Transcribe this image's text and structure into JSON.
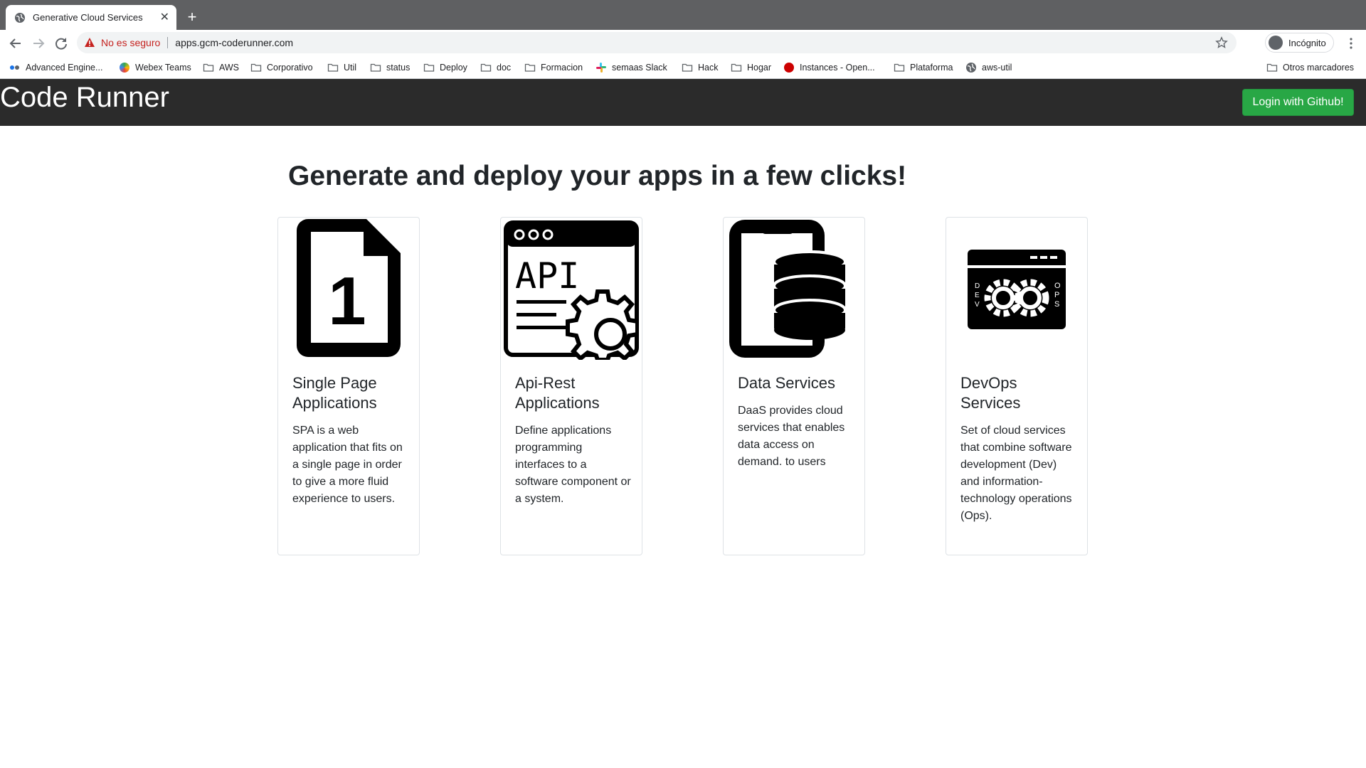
{
  "browser": {
    "tab_title": "Generative Cloud Services",
    "security_label": "No es seguro",
    "url": "apps.gcm-coderunner.com",
    "profile_label": "Incógnito"
  },
  "bookmarks": [
    {
      "label": "Advanced Engine...",
      "icon": "apps-icon"
    },
    {
      "label": "Webex Teams",
      "icon": "webex-icon"
    },
    {
      "label": "AWS",
      "icon": "folder-icon"
    },
    {
      "label": "Corporativo",
      "icon": "folder-icon"
    },
    {
      "label": "Util",
      "icon": "folder-icon"
    },
    {
      "label": "status",
      "icon": "folder-icon"
    },
    {
      "label": "Deploy",
      "icon": "folder-icon"
    },
    {
      "label": "doc",
      "icon": "folder-icon"
    },
    {
      "label": "Formacion",
      "icon": "folder-icon"
    },
    {
      "label": "semaas Slack",
      "icon": "slack-icon"
    },
    {
      "label": "Hack",
      "icon": "folder-icon"
    },
    {
      "label": "Hogar",
      "icon": "folder-icon"
    },
    {
      "label": "Instances - Open...",
      "icon": "redhat-icon"
    },
    {
      "label": "Plataforma",
      "icon": "folder-icon"
    },
    {
      "label": "aws-util",
      "icon": "globe-icon"
    },
    {
      "label": "Otros marcadores",
      "icon": "folder-icon"
    }
  ],
  "app": {
    "brand": "Code Runner",
    "login_label": "Login with Github!",
    "headline": "Generate and deploy your apps in a few clicks!"
  },
  "cards": [
    {
      "title": "Single Page Applications",
      "text": "SPA is a web application that fits on a single page in order to give a more fluid experience to users.",
      "icon": "spa-document-icon",
      "icon_glyph": "1"
    },
    {
      "title": "Api-Rest Applications",
      "text": "Define applications programming interfaces to a software component or a system.",
      "icon": "api-window-gear-icon",
      "icon_glyph": "API"
    },
    {
      "title": "Data Services",
      "text": "DaaS provides cloud services that enables data access on demand. to users",
      "icon": "phone-database-icon"
    },
    {
      "title": "DevOps Services",
      "text": "Set of cloud services that combine software development (Dev) and information-technology operations (Ops).",
      "icon": "devops-window-icon",
      "icon_glyph_left": "DEV",
      "icon_glyph_right": "OPS"
    }
  ]
}
